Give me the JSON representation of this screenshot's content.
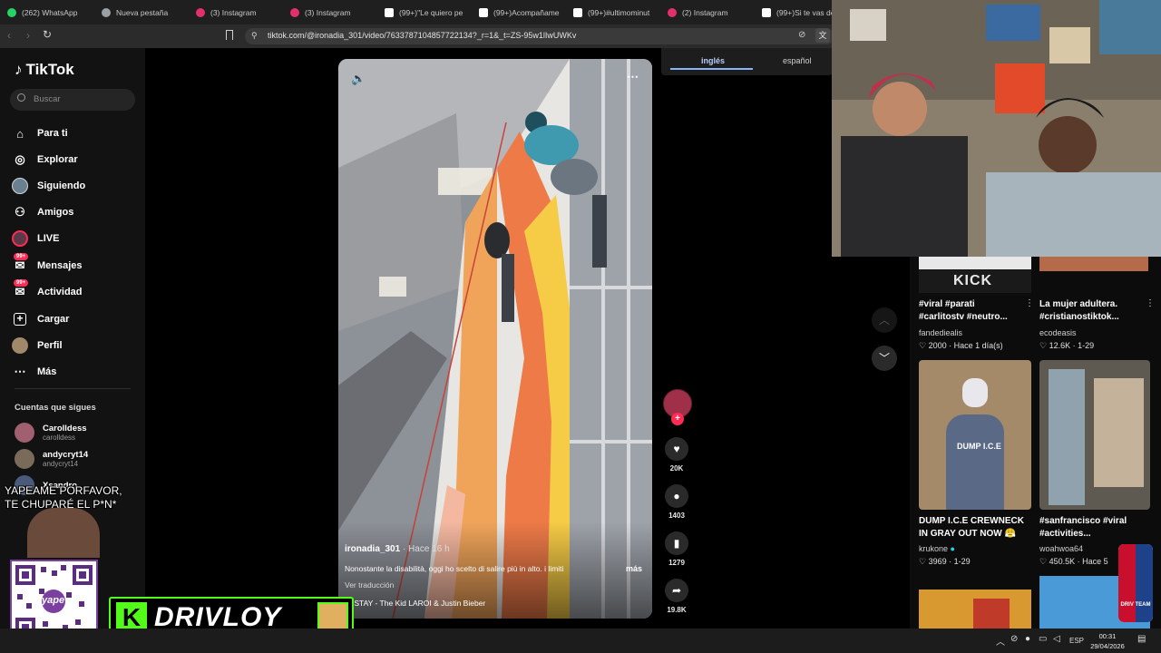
{
  "browser": {
    "tabs": [
      {
        "label": "(262) WhatsApp",
        "color": "#25d366"
      },
      {
        "label": "Nueva pestaña",
        "color": "#9aa0a6"
      },
      {
        "label": "(3) Instagram",
        "color": "#e1306c"
      },
      {
        "label": "(3) Instagram",
        "color": "#e1306c"
      },
      {
        "label": "(99+)\"Le quiero pe",
        "color": "#ffffff"
      },
      {
        "label": "(99+)Acompañame",
        "color": "#ffffff"
      },
      {
        "label": "(99+)#ultimominut",
        "color": "#ffffff"
      },
      {
        "label": "(2) Instagram",
        "color": "#e1306c"
      },
      {
        "label": "(99+)Si te vas de",
        "color": "#ffffff"
      }
    ],
    "url": "tiktok.com/@ironadia_301/video/7633787104857722134?_r=1&_t=ZS-95w1lIwUWKv"
  },
  "translate_popup": {
    "tab_active": "inglés",
    "tab_other": "español"
  },
  "sidebar": {
    "logo": "TikTok",
    "search_placeholder": "Buscar",
    "nav": [
      {
        "label": "Para ti",
        "icon": "home-icon"
      },
      {
        "label": "Explorar",
        "icon": "compass-icon"
      },
      {
        "label": "Siguiendo",
        "icon": "following-icon"
      },
      {
        "label": "Amigos",
        "icon": "friends-icon"
      },
      {
        "label": "LIVE",
        "icon": "live-icon"
      },
      {
        "label": "Mensajes",
        "icon": "messages-icon",
        "badge": "99+"
      },
      {
        "label": "Actividad",
        "icon": "activity-icon",
        "badge": "99+"
      },
      {
        "label": "Cargar",
        "icon": "upload-icon"
      },
      {
        "label": "Perfil",
        "icon": "profile-icon"
      },
      {
        "label": "Más",
        "icon": "more-icon"
      }
    ],
    "following_title": "Cuentas que sigues",
    "following": [
      {
        "name": "Carolldess",
        "user": "carolldess"
      },
      {
        "name": "andycryt14",
        "user": "andycryt14"
      },
      {
        "name": "Xsandro",
        "user": ""
      }
    ]
  },
  "overlay": {
    "caption_line1": "YAPEAME PORFAVOR,",
    "caption_line2": "TE CHUPARÉ  EL P*N*",
    "qr_label": "yape",
    "channel_name": "DRIVLOY",
    "badge_k": "K",
    "badge_text": "DRIV TEAM"
  },
  "video": {
    "author": "ironadia_301",
    "time": "· Hace 16 h",
    "description": "Nonostante la disabilità, oggi ho scelto di salire più in alto. i limiti",
    "more": "más",
    "translate": "Ver traducción",
    "music": "STAY - The Kid LAROI & Justin Bieber",
    "likes": "20K",
    "comments": "1403",
    "saves": "1279",
    "shares": "19.8K"
  },
  "grid": [
    {
      "title": "#viral #parati #carlitostv #neutro...",
      "author": "fandediealis",
      "likes": "2000",
      "date": "Hace 1 día(s)",
      "thumb_text": "KICK",
      "verified": false
    },
    {
      "title": "La mujer adultera. #cristianostiktok...",
      "author": "ecodeasis",
      "likes": "12.6K",
      "date": "1-29",
      "thumb_text": "",
      "verified": false
    },
    {
      "title": "DUMP I.C.E CREWNECK IN GRAY OUT NOW 😤",
      "author": "krukone",
      "likes": "3969",
      "date": "1-29",
      "thumb_text": "DUMP I.C.E",
      "verified": true
    },
    {
      "title": "#sanfrancisco #viral #activities...",
      "author": "woahwoa64",
      "likes": "450.5K",
      "date": "Hace 5",
      "thumb_text": "",
      "verified": false
    }
  ],
  "taskbar": {
    "lang": "ESP",
    "time": "00:31",
    "date": "29/04/2026"
  }
}
